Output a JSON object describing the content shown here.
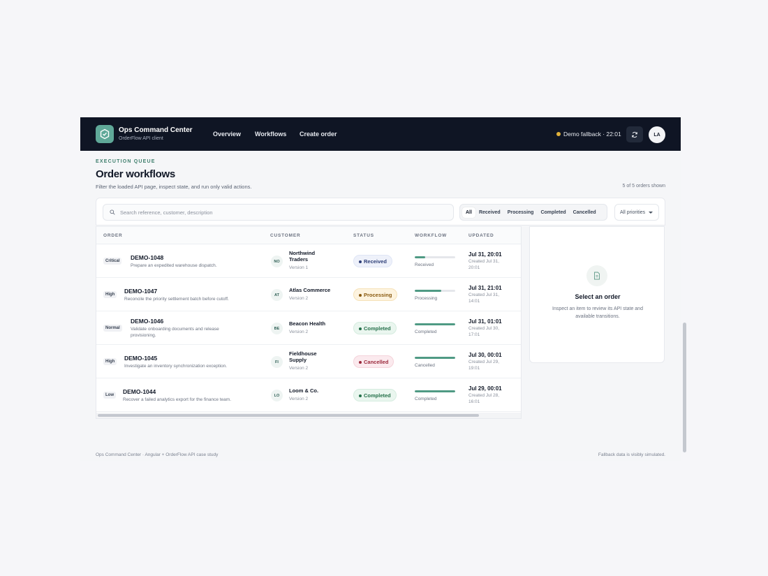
{
  "header": {
    "title": "Ops Command Center",
    "subtitle": "OrderFlow API client",
    "nav": [
      "Overview",
      "Workflows",
      "Create order"
    ],
    "status": "Demo fallback · 22:01",
    "avatar": "LA",
    "status_color": "#e0b13a"
  },
  "page": {
    "eyebrow": "EXECUTION QUEUE",
    "title": "Order workflows",
    "subtitle": "Filter the loaded API page, inspect state, and run only valid actions.",
    "count": "5 of 5 orders shown"
  },
  "filters": {
    "search_placeholder": "Search reference, customer, description",
    "statuses": [
      "All",
      "Received",
      "Processing",
      "Completed",
      "Cancelled"
    ],
    "active_status": "All",
    "priority": "All priorities"
  },
  "table": {
    "columns": [
      "ORDER",
      "CUSTOMER",
      "STATUS",
      "WORKFLOW",
      "UPDATED"
    ],
    "rows": [
      {
        "priority": "Critical",
        "ref": "DEMO-1048",
        "desc": "Prepare an expedited warehouse dispatch.",
        "cust_initials": "NO",
        "customer": "Northwind Traders",
        "version": "Version 1",
        "status": "Received",
        "progress": 0.25,
        "workflow": "Received",
        "updated": "Jul 31, 20:01",
        "created": "Created Jul 31, 20:01"
      },
      {
        "priority": "High",
        "ref": "DEMO-1047",
        "desc": "Reconcile the priority settlement batch before cutoff.",
        "cust_initials": "AT",
        "customer": "Atlas Commerce",
        "version": "Version 2",
        "status": "Processing",
        "progress": 0.65,
        "workflow": "Processing",
        "updated": "Jul 31, 21:01",
        "created": "Created Jul 31, 14:01"
      },
      {
        "priority": "Normal",
        "ref": "DEMO-1046",
        "desc": "Validate onboarding documents and release provisioning.",
        "cust_initials": "BE",
        "customer": "Beacon Health",
        "version": "Version 2",
        "status": "Completed",
        "progress": 1.0,
        "workflow": "Completed",
        "updated": "Jul 31, 01:01",
        "created": "Created Jul 30, 17:01"
      },
      {
        "priority": "High",
        "ref": "DEMO-1045",
        "desc": "Investigate an inventory synchronization exception.",
        "cust_initials": "FI",
        "customer": "Fieldhouse Supply",
        "version": "Version 2",
        "status": "Cancelled",
        "progress": 1.0,
        "workflow": "Cancelled",
        "updated": "Jul 30, 00:01",
        "created": "Created Jul 29, 19:01"
      },
      {
        "priority": "Low",
        "ref": "DEMO-1044",
        "desc": "Recover a failed analytics export for the finance team.",
        "cust_initials": "LO",
        "customer": "Loom & Co.",
        "version": "Version 2",
        "status": "Completed",
        "progress": 1.0,
        "workflow": "Completed",
        "updated": "Jul 29, 00:01",
        "created": "Created Jul 28, 16:01"
      }
    ]
  },
  "detail": {
    "title": "Select an order",
    "text": "Inspect an item to review its API state and available transitions."
  },
  "footer": {
    "left": "Ops Command Center · Angular + OrderFlow API case study",
    "right": "Fallback data is visibly simulated."
  }
}
